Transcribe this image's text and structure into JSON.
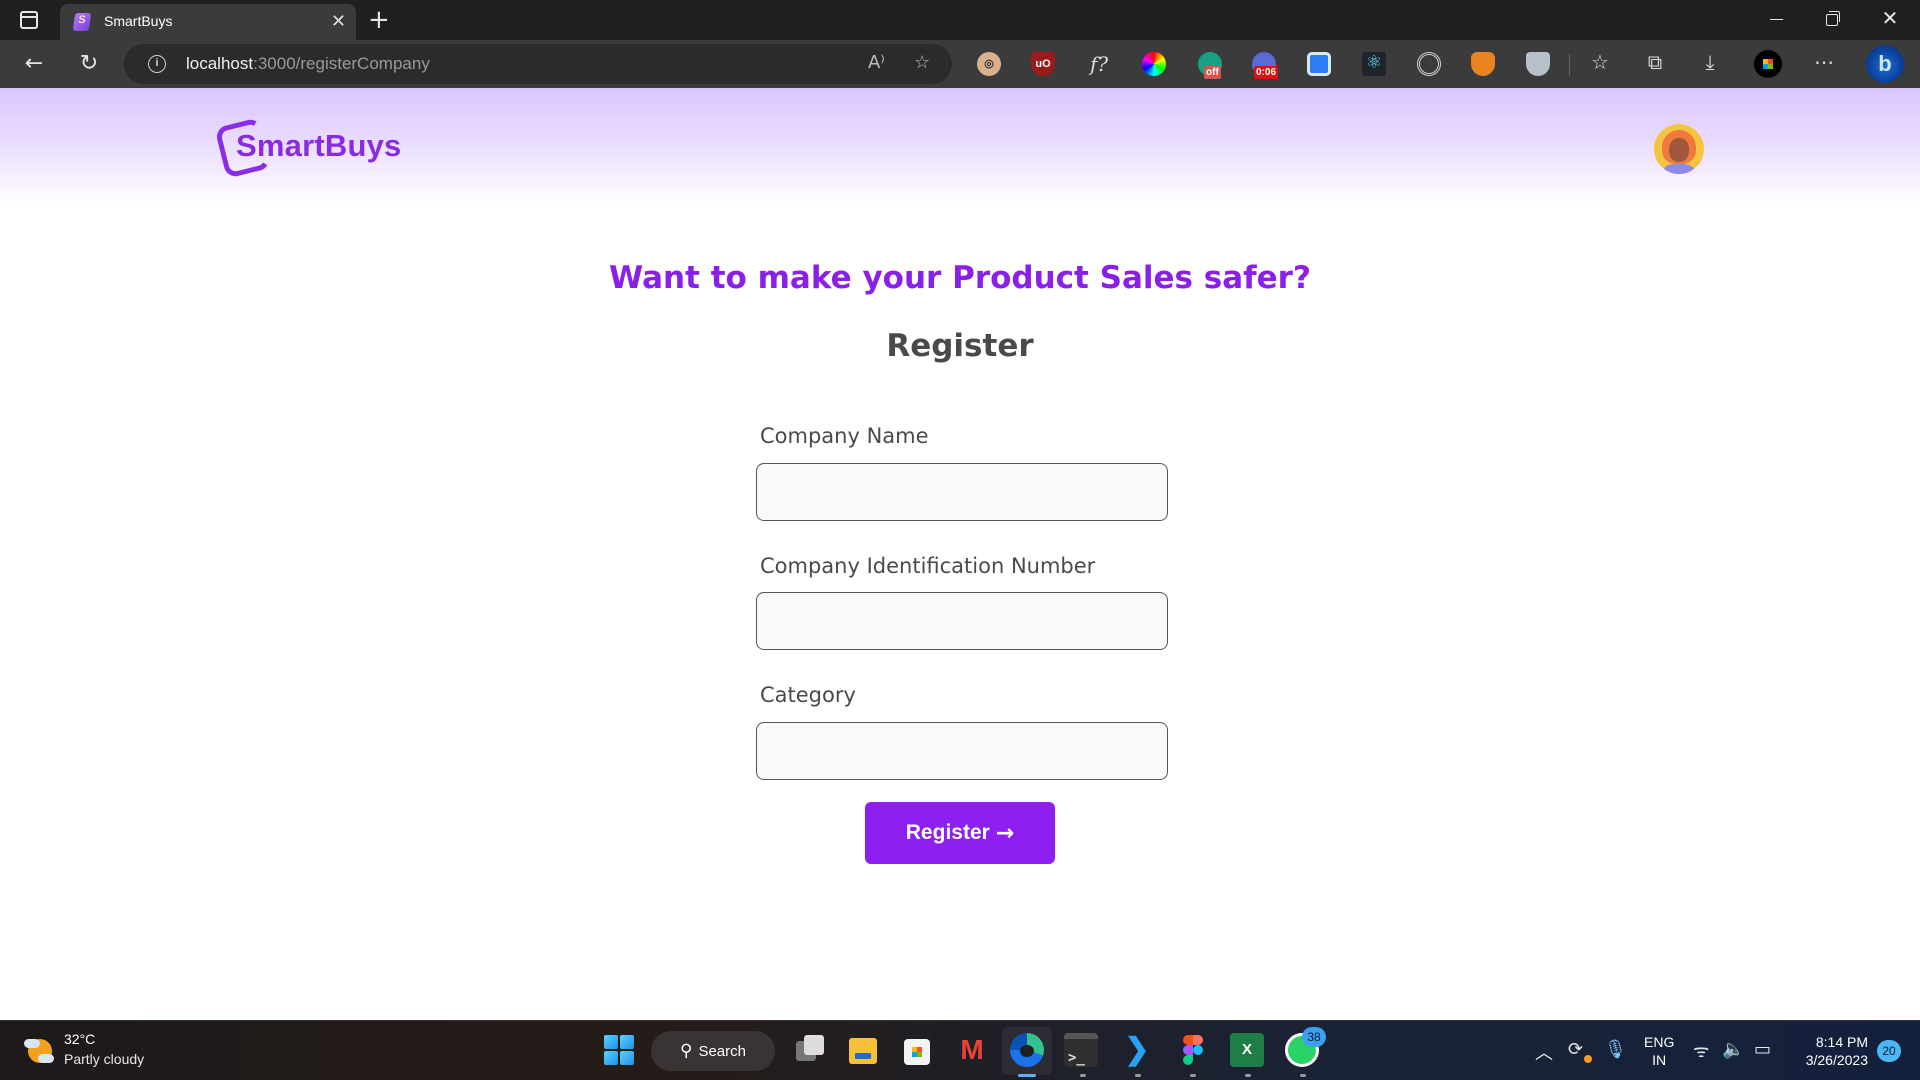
{
  "browser": {
    "tab_title": "SmartBuys",
    "url_host": "localhost",
    "url_path": ":3000/registerCompany",
    "extensions": [
      {
        "name": "owl-extension",
        "badge": ""
      },
      {
        "name": "ublock-origin",
        "badge": ""
      },
      {
        "name": "whatfont",
        "badge": ""
      },
      {
        "name": "color-picker",
        "badge": ""
      },
      {
        "name": "grammarly",
        "badge": "off"
      },
      {
        "name": "timer-extension",
        "badge": "0:06"
      },
      {
        "name": "screen-recorder",
        "badge": ""
      },
      {
        "name": "react-devtools",
        "badge": ""
      },
      {
        "name": "target-extension",
        "badge": ""
      },
      {
        "name": "metamask",
        "badge": ""
      },
      {
        "name": "shield-extension",
        "badge": ""
      }
    ]
  },
  "header": {
    "logo_text": "SmartBuys"
  },
  "main": {
    "headline": "Want to make your Product Sales safer?",
    "subheading": "Register",
    "fields": [
      {
        "label": "Company Name",
        "value": "",
        "placeholder": ""
      },
      {
        "label": "Company Identification Number",
        "value": "",
        "placeholder": ""
      },
      {
        "label": "Category",
        "value": "",
        "placeholder": ""
      }
    ],
    "submit_label": "Register",
    "submit_icon": "→"
  },
  "colors": {
    "brand": "#8a2be2",
    "button": "#8f1ff0",
    "headline": "#8a1fe8",
    "text": "#4a4a4a"
  },
  "taskbar": {
    "weather_temp": "32°C",
    "weather_desc": "Partly cloudy",
    "search_label": "Search",
    "whatsapp_badge": "38",
    "lang_line1": "ENG",
    "lang_line2": "IN",
    "time": "8:14 PM",
    "date": "3/26/2023",
    "notification_count": "20"
  }
}
